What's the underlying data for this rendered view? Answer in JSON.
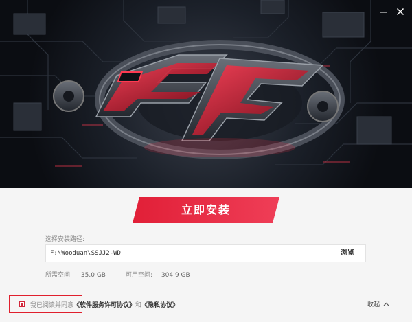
{
  "install": {
    "label": "立即安装"
  },
  "path": {
    "label": "选择安装路径:",
    "value": "F:\\Wooduan\\SSJJ2-WD",
    "browse_label": "浏览"
  },
  "space": {
    "required_label": "所需空间:",
    "required_value": "35.0 GB",
    "available_label": "可用空间:",
    "available_value": "304.9 GB"
  },
  "agreement": {
    "prefix": "我已阅读并同意",
    "license_link": "《软件服务许可协议》",
    "conjunction": "和",
    "privacy_link": "《隐私协议》",
    "checked": true
  },
  "collapse": {
    "label": "收起"
  },
  "colors": {
    "accent": "#e3283e",
    "hero_bg": "#12161d",
    "panel_bg": "#f5f5f5"
  },
  "icons": {
    "minimize": "minimize-icon",
    "close": "close-icon",
    "collapse": "chevron-up-icon"
  }
}
